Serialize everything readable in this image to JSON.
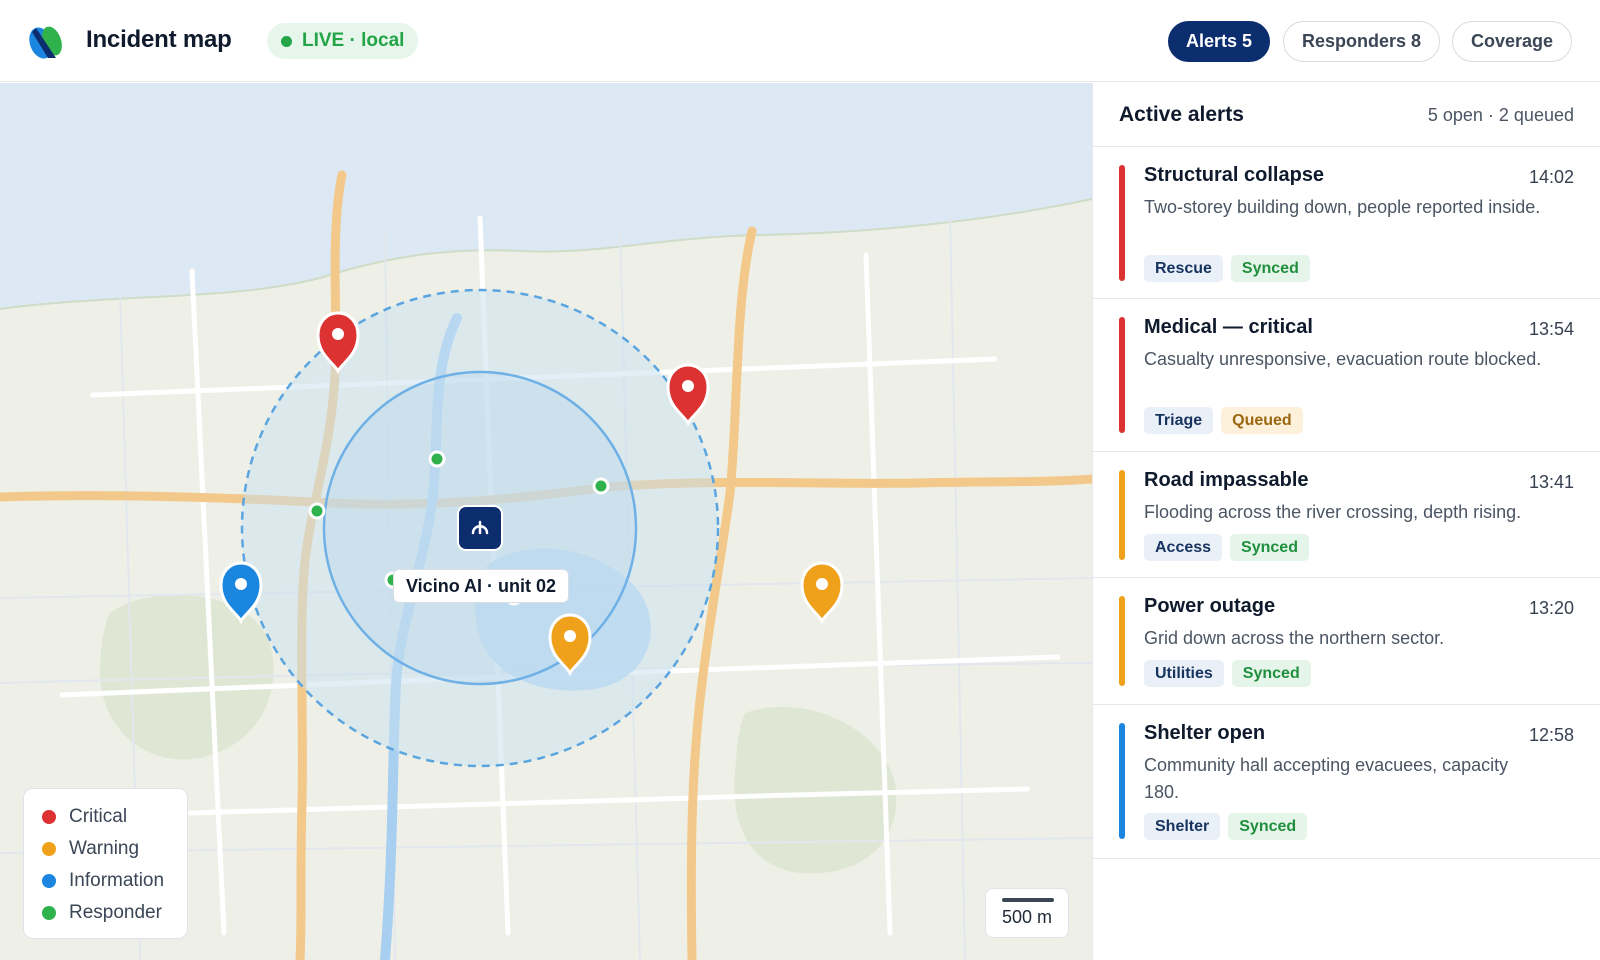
{
  "header": {
    "title": "Incident map",
    "live_label": "LIVE · local",
    "nav": [
      {
        "label": "Alerts 5",
        "active": true
      },
      {
        "label": "Responders 8",
        "active": false
      },
      {
        "label": "Coverage",
        "active": false
      }
    ]
  },
  "colors": {
    "critical": "#dc3232",
    "warning": "#f0a11b",
    "information": "#1a86e0",
    "responder": "#2fb24c",
    "primary": "#0d2e6e"
  },
  "map": {
    "unit_label": "Vicino AI · unit 02",
    "scale_label": "500 m",
    "legend": [
      {
        "label": "Critical",
        "color": "#dc3232"
      },
      {
        "label": "Warning",
        "color": "#f0a11b"
      },
      {
        "label": "Information",
        "color": "#1a86e0"
      },
      {
        "label": "Responder",
        "color": "#2fb24c"
      }
    ]
  },
  "alerts_panel": {
    "title": "Active alerts",
    "summary": "5 open · 2 queued",
    "alerts": [
      {
        "title": "Structural collapse",
        "time": "14:02",
        "description": "Two-storey building down, people reported inside.",
        "category": "Rescue",
        "status": "Synced",
        "severity_color": "#dc3232"
      },
      {
        "title": "Medical — critical",
        "time": "13:54",
        "description": "Casualty unresponsive, evacuation route blocked.",
        "category": "Triage",
        "status": "Queued",
        "severity_color": "#dc3232"
      },
      {
        "title": "Road impassable",
        "time": "13:41",
        "description": "Flooding across the river crossing, depth rising.",
        "category": "Access",
        "status": "Synced",
        "severity_color": "#f0a11b"
      },
      {
        "title": "Power outage",
        "time": "13:20",
        "description": "Grid down across the northern sector.",
        "category": "Utilities",
        "status": "Synced",
        "severity_color": "#f0a11b"
      },
      {
        "title": "Shelter open",
        "time": "12:58",
        "description": "Community hall accepting evacuees, capacity 180.",
        "category": "Shelter",
        "status": "Synced",
        "severity_color": "#1a86e0"
      }
    ]
  }
}
